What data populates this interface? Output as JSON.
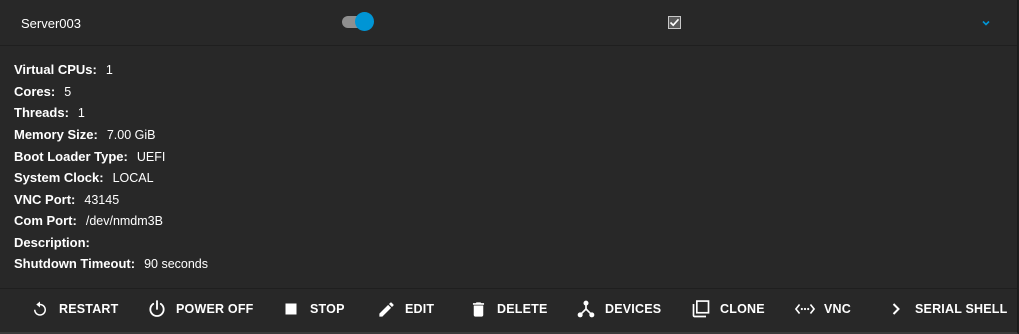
{
  "vm": {
    "name": "Server003",
    "running": true,
    "autostart": true
  },
  "details": [
    {
      "label": "Virtual CPUs:",
      "value": "1"
    },
    {
      "label": "Cores:",
      "value": "5"
    },
    {
      "label": "Threads:",
      "value": "1"
    },
    {
      "label": "Memory Size:",
      "value": "7.00 GiB"
    },
    {
      "label": "Boot Loader Type:",
      "value": "UEFI"
    },
    {
      "label": "System Clock:",
      "value": "LOCAL"
    },
    {
      "label": "VNC Port:",
      "value": "43145"
    },
    {
      "label": "Com Port:",
      "value": "/dev/nmdm3B"
    },
    {
      "label": "Description:",
      "value": ""
    },
    {
      "label": "Shutdown Timeout:",
      "value": "90 seconds"
    }
  ],
  "actions": [
    {
      "label": "RESTART",
      "icon": "restart-icon"
    },
    {
      "label": "POWER OFF",
      "icon": "power-icon"
    },
    {
      "label": "STOP",
      "icon": "stop-icon"
    },
    {
      "label": "EDIT",
      "icon": "pencil-icon"
    },
    {
      "label": "DELETE",
      "icon": "trash-icon"
    },
    {
      "label": "DEVICES",
      "icon": "devices-icon"
    },
    {
      "label": "CLONE",
      "icon": "clone-icon"
    },
    {
      "label": "VNC",
      "icon": "vnc-icon"
    },
    {
      "label": "SERIAL SHELL",
      "icon": "chevron-right-icon"
    }
  ],
  "colors": {
    "accent": "#0095d5",
    "background": "#282828",
    "text": "#ffffff"
  }
}
